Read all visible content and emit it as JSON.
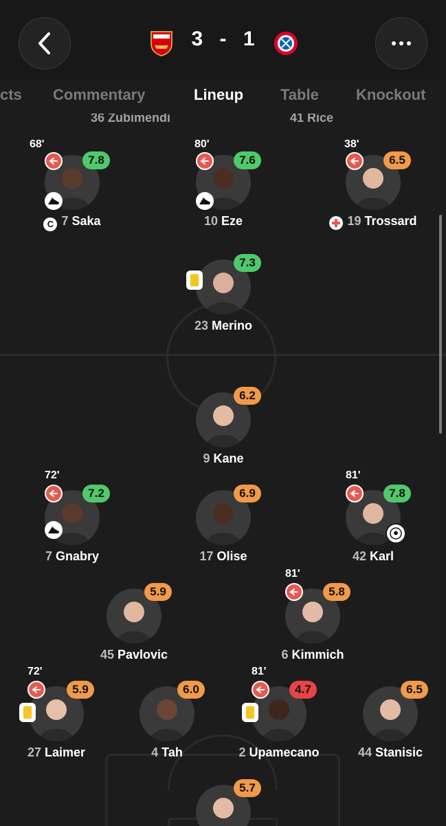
{
  "match": {
    "home_crest": "arsenal-crest",
    "away_crest": "bayern-crest",
    "home_score": "3",
    "separator": "-",
    "away_score": "1"
  },
  "tabs": [
    {
      "label": "cts"
    },
    {
      "label": "Commentary"
    },
    {
      "label": "Lineup",
      "active": true
    },
    {
      "label": "Table"
    },
    {
      "label": "Knockout"
    }
  ],
  "cutoff_names": [
    "36 Zubimendi",
    "41 Rice"
  ],
  "arsenal": {
    "saka": {
      "number": "7",
      "name": "Saka",
      "rating": "7.8",
      "sub_minute": "68'"
    },
    "eze": {
      "number": "10",
      "name": "Eze",
      "rating": "7.6",
      "sub_minute": "80'"
    },
    "trossard": {
      "number": "19",
      "name": "Trossard",
      "rating": "6.5",
      "sub_minute": "38'"
    },
    "merino": {
      "number": "23",
      "name": "Merino",
      "rating": "7.3"
    }
  },
  "bayern": {
    "kane": {
      "number": "9",
      "name": "Kane",
      "rating": "6.2"
    },
    "gnabry": {
      "number": "7",
      "name": "Gnabry",
      "rating": "7.2",
      "sub_minute": "72'"
    },
    "olise": {
      "number": "17",
      "name": "Olise",
      "rating": "6.9"
    },
    "karl": {
      "number": "42",
      "name": "Karl",
      "rating": "7.8",
      "sub_minute": "81'"
    },
    "pavlovic": {
      "number": "45",
      "name": "Pavlovic",
      "rating": "5.9"
    },
    "kimmich": {
      "number": "6",
      "name": "Kimmich",
      "rating": "5.8",
      "sub_minute": "81'"
    },
    "laimer": {
      "number": "27",
      "name": "Laimer",
      "rating": "5.9",
      "sub_minute": "72'"
    },
    "tah": {
      "number": "4",
      "name": "Tah",
      "rating": "6.0"
    },
    "upamecano": {
      "number": "2",
      "name": "Upamecano",
      "rating": "4.7",
      "sub_minute": "81'"
    },
    "stanisic": {
      "number": "44",
      "name": "Stanisic",
      "rating": "6.5"
    },
    "keeper": {
      "rating": "5.7"
    }
  },
  "colors": {
    "rating_green": "#4fc96b",
    "rating_orange": "#f09a4a",
    "rating_red": "#e84444",
    "sub_off": "#e55a50",
    "background": "#1c1c1c"
  }
}
